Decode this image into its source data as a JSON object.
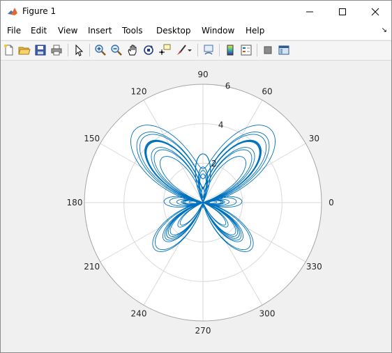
{
  "window": {
    "title": "Figure 1",
    "controls": [
      "minimize",
      "maximize",
      "close"
    ]
  },
  "menubar": {
    "items": [
      "File",
      "Edit",
      "View",
      "Insert",
      "Tools",
      "Desktop",
      "Window",
      "Help"
    ]
  },
  "toolbar": {
    "icons": [
      "new-figure-icon",
      "open-file-icon",
      "save-icon",
      "print-icon",
      "pointer-icon",
      "zoom-in-icon",
      "zoom-out-icon",
      "pan-icon",
      "rotate-3d-icon",
      "data-cursor-icon",
      "brush-icon",
      "link-plot-icon",
      "colorbar-icon",
      "legend-icon",
      "hide-plot-tools-icon",
      "show-plot-tools-icon"
    ]
  },
  "colors": {
    "line": "#0072bd",
    "grid": "#d9d9d9",
    "axis_bg": "#ffffff",
    "figure_bg": "#f0f0f0"
  },
  "chart_data": {
    "type": "line",
    "coordinate_system": "polar",
    "function": "r = exp(sin(theta)) - 2*cos(4*theta) + sin((2*theta - pi)/24)^5",
    "theta_range_deg": [
      0,
      4320
    ],
    "rlim": [
      0,
      6
    ],
    "r_ticks": [
      "2",
      "4",
      "6"
    ],
    "theta_ticks": [
      "0",
      "30",
      "60",
      "90",
      "120",
      "150",
      "180",
      "210",
      "240",
      "270",
      "300",
      "330"
    ],
    "series": [
      {
        "color": "#0072bd"
      }
    ],
    "grid": true
  }
}
